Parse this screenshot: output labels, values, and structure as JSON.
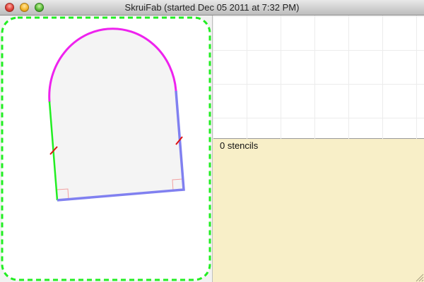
{
  "window": {
    "title": "SkruiFab (started Dec 05 2011 at 7:32 PM)"
  },
  "titlebar_buttons": {
    "close_icon": "traffic-light-close",
    "minimize_icon": "traffic-light-minimize",
    "zoom_icon": "traffic-light-zoom"
  },
  "stencil_panel": {
    "status": "0 stencils"
  },
  "colors": {
    "selection_outline": "#22ee22",
    "arc_edge": "#ee22ee",
    "left_edge": "#22ee22",
    "straight_edges": "#8080f0",
    "shape_fill": "#f4f4f4",
    "marker": "#dd1111",
    "status_background": "#f8efc8"
  }
}
